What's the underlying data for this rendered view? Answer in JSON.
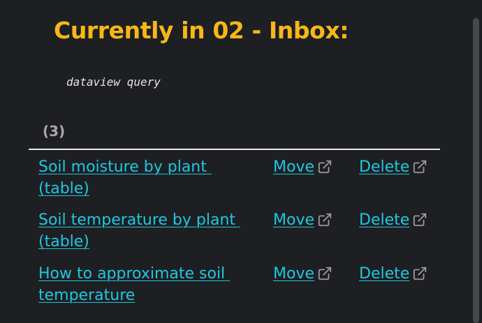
{
  "heading": "Currently in 02 - Inbox:",
  "code_block": "dataview query",
  "result_count": "(3)",
  "colors": {
    "heading": "#f6b718",
    "link": "#1ec8e1",
    "background": "#1e1f22"
  },
  "rows": [
    {
      "title": "Soil moisture by plant (table)",
      "move_label": "Move",
      "delete_label": "Delete"
    },
    {
      "title": "Soil temperature by plant (table)",
      "move_label": "Move",
      "delete_label": "Delete"
    },
    {
      "title": "How to approximate soil temperature",
      "move_label": "Move",
      "delete_label": "Delete"
    }
  ],
  "icons": {
    "external_link": "external-link-icon"
  }
}
